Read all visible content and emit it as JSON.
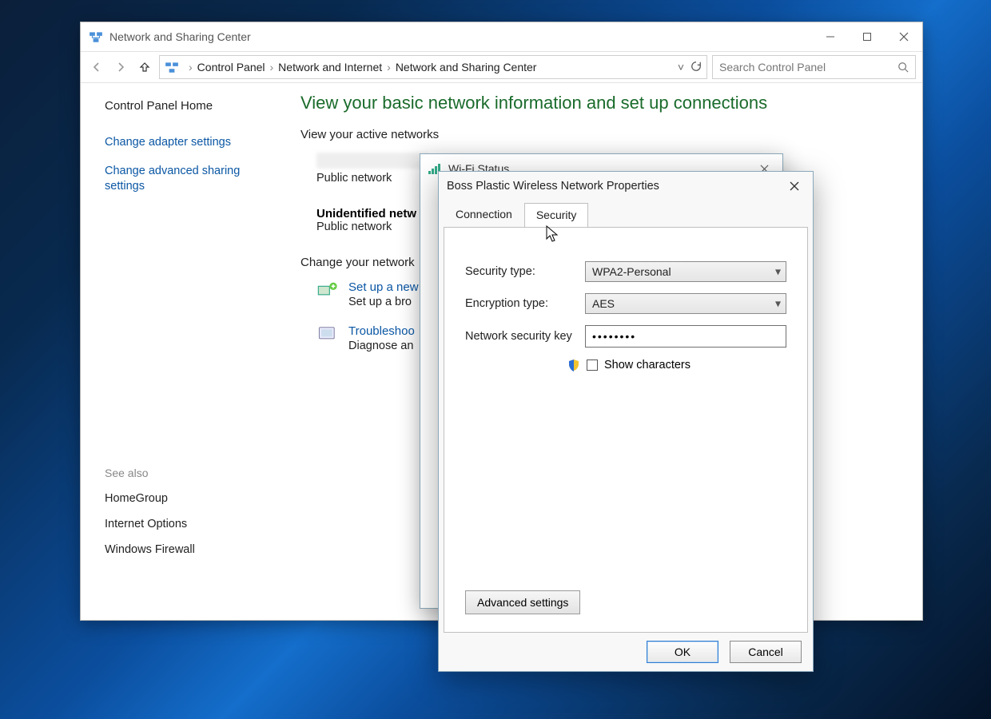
{
  "mainWindow": {
    "title": "Network and Sharing Center",
    "breadcrumbs": {
      "b1": "Control Panel",
      "b2": "Network and Internet",
      "b3": "Network and Sharing Center"
    },
    "search_placeholder": "Search Control Panel"
  },
  "sidebar": {
    "home": "Control Panel Home",
    "links": {
      "l1": "Change adapter settings",
      "l2": "Change advanced sharing settings"
    },
    "seeAlsoHeading": "See also",
    "seeAlso": {
      "s1": "HomeGroup",
      "s2": "Internet Options",
      "s3": "Windows Firewall"
    }
  },
  "main": {
    "heading": "View your basic network information and set up connections",
    "activeHeading": "View your active networks",
    "publicNetwork": "Public network",
    "unidentified": "Unidentified netw",
    "changeHeading": "Change your network",
    "setup_title": "Set up a new",
    "setup_desc": "Set up a bro",
    "trouble_title": "Troubleshoo",
    "trouble_desc": "Diagnose an"
  },
  "wifiStatus": {
    "title": "Wi-Fi Status"
  },
  "props": {
    "title": "Boss Plastic Wireless Network Properties",
    "tabs": {
      "connection": "Connection",
      "security": "Security"
    },
    "labels": {
      "secType": "Security type:",
      "encType": "Encryption type:",
      "key": "Network security key",
      "show": "Show characters",
      "advanced": "Advanced settings",
      "ok": "OK",
      "cancel": "Cancel"
    },
    "values": {
      "secType": "WPA2-Personal",
      "encType": "AES",
      "keyMask": "••••••••"
    }
  }
}
